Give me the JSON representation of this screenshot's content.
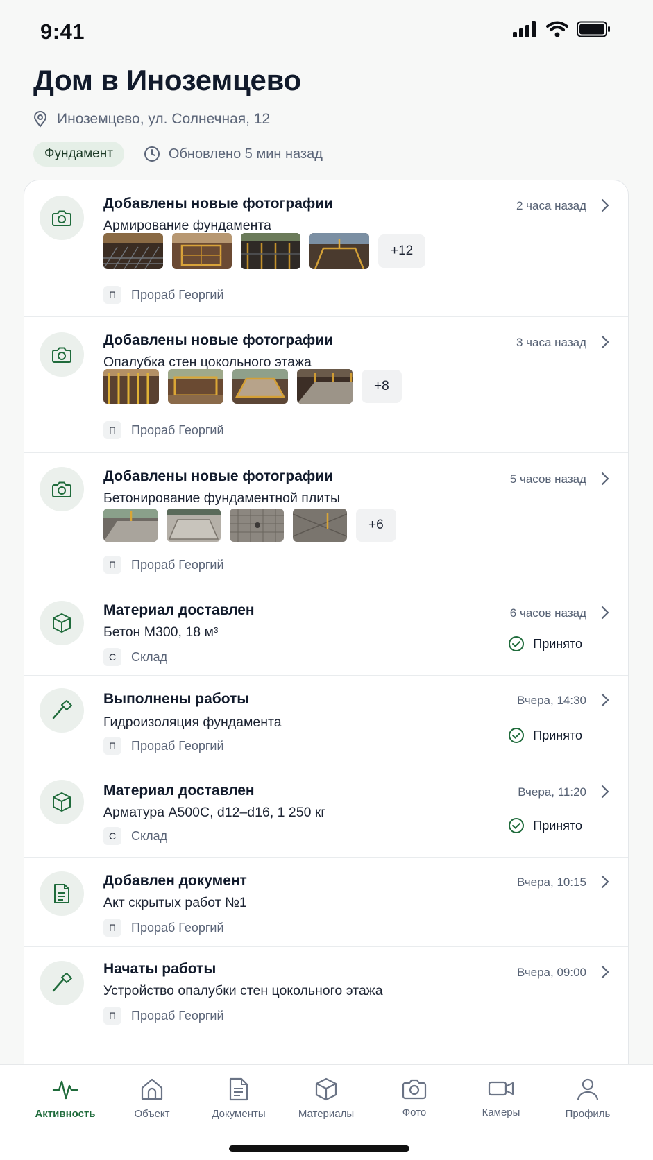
{
  "status_bar": {
    "time": "9:41"
  },
  "header": {
    "title": "Дом в Иноземцево",
    "address": "Иноземцево, ул. Солнечная, 12",
    "stage": "Фундамент",
    "updated": "Обновлено 5 мин назад"
  },
  "feed": [
    {
      "icon": "camera-icon",
      "title": "Добавлены новые фотографии",
      "subtitle": "Армирование фундамента",
      "time": "2 часа назад",
      "more": "+12",
      "author_initial": "П",
      "author": "Прораб Георгий"
    },
    {
      "icon": "camera-icon",
      "title": "Добавлены новые фотографии",
      "subtitle": "Опалубка стен цокольного этажа",
      "time": "3 часа назад",
      "more": "+8",
      "author_initial": "П",
      "author": "Прораб Георгий"
    },
    {
      "icon": "camera-icon",
      "title": "Добавлены новые фотографии",
      "subtitle": "Бетонирование фундаментной плиты",
      "time": "5 часов назад",
      "more": "+6",
      "author_initial": "П",
      "author": "Прораб Георгий"
    },
    {
      "icon": "box-icon",
      "title": "Материал доставлен",
      "subtitle": "Бетон М300, 18 м³",
      "time": "6 часов назад",
      "status": "Принято",
      "author_initial": "С",
      "author": "Склад"
    },
    {
      "icon": "hammer-icon",
      "title": "Выполнены работы",
      "subtitle": "Гидроизоляция фундамента",
      "time": "Вчера, 14:30",
      "status": "Принято",
      "author_initial": "П",
      "author": "Прораб Георгий"
    },
    {
      "icon": "box-icon",
      "title": "Материал доставлен",
      "subtitle": "Арматура А500С, d12–d16, 1 250 кг",
      "time": "Вчера, 11:20",
      "status": "Принято",
      "author_initial": "С",
      "author": "Склад"
    },
    {
      "icon": "document-icon",
      "title": "Добавлен документ",
      "subtitle": "Акт скрытых работ №1",
      "time": "Вчера, 10:15",
      "author_initial": "П",
      "author": "Прораб Георгий"
    },
    {
      "icon": "hammer-icon",
      "title": "Начаты работы",
      "subtitle": "Устройство опалубки стен цокольного этажа",
      "time": "Вчера, 09:00",
      "author_initial": "П",
      "author": "Прораб Георгий"
    }
  ],
  "tabs": [
    {
      "label": "Активность",
      "icon": "activity-icon",
      "active": true
    },
    {
      "label": "Объект",
      "icon": "home-icon"
    },
    {
      "label": "Документы",
      "icon": "document-icon"
    },
    {
      "label": "Материалы",
      "icon": "box-icon"
    },
    {
      "label": "Фото",
      "icon": "camera-icon"
    },
    {
      "label": "Камеры",
      "icon": "video-icon"
    },
    {
      "label": "Профиль",
      "icon": "user-icon"
    }
  ],
  "colors": {
    "accent": "#1f6b3b",
    "badge_bg": "#e5efe7",
    "icon_bg": "#ebf0ec"
  }
}
